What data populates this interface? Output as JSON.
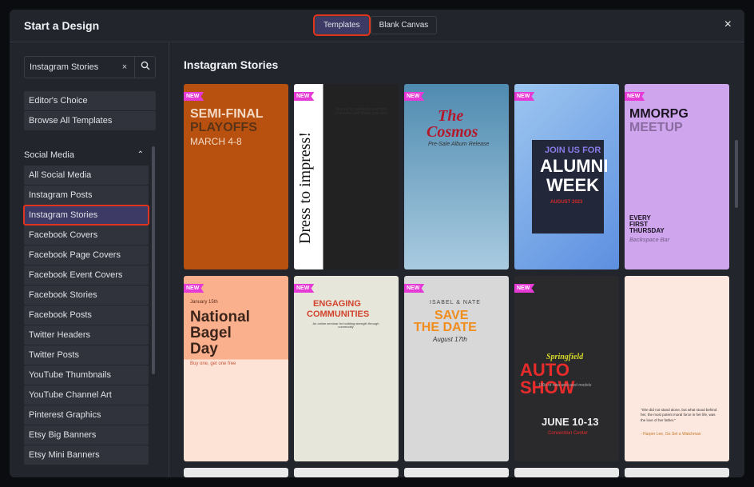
{
  "header": {
    "title": "Start a Design",
    "tabs": [
      {
        "label": "Templates",
        "active": true
      },
      {
        "label": "Blank Canvas",
        "active": false
      }
    ],
    "close_icon": "×"
  },
  "sidebar": {
    "search": {
      "value": "Instagram Stories",
      "placeholder": "",
      "clear": "×",
      "search_icon": "⚲"
    },
    "quick": [
      {
        "label": "Editor's Choice"
      },
      {
        "label": "Browse All Templates"
      }
    ],
    "section": {
      "label": "Social Media",
      "chevron": "⌃"
    },
    "items": [
      {
        "label": "All Social Media"
      },
      {
        "label": "Instagram Posts"
      },
      {
        "label": "Instagram Stories",
        "active": true
      },
      {
        "label": "Facebook Covers"
      },
      {
        "label": "Facebook Page Covers"
      },
      {
        "label": "Facebook Event Covers"
      },
      {
        "label": "Facebook Stories"
      },
      {
        "label": "Facebook Posts"
      },
      {
        "label": "Twitter Headers"
      },
      {
        "label": "Twitter Posts"
      },
      {
        "label": "YouTube Thumbnails"
      },
      {
        "label": "YouTube Channel Art"
      },
      {
        "label": "Pinterest Graphics"
      },
      {
        "label": "Etsy Big Banners"
      },
      {
        "label": "Etsy Mini Banners"
      }
    ]
  },
  "main": {
    "title": "Instagram Stories",
    "badge": "NEW",
    "cards": [
      {
        "name": "semi-final-playoffs",
        "lines": [
          "SEMI-FINAL",
          "PLAYOFFS",
          "MARCH 4-8"
        ],
        "new": true
      },
      {
        "name": "dress-to-impress",
        "lines": [
          "Dress to impress!",
          "Join us for cocktails and hors d'oeuvres and dress your best"
        ],
        "new": true
      },
      {
        "name": "the-cosmos",
        "lines": [
          "The",
          "Cosmos",
          "Pre-Sale Album Release"
        ],
        "new": true
      },
      {
        "name": "alumni-week",
        "lines": [
          "JOIN US FOR",
          "ALUMNI",
          "WEEK",
          "AUGUST 2023"
        ],
        "new": true
      },
      {
        "name": "mmorpg-meetup",
        "lines": [
          "MMORPG",
          "MEETUP",
          "EVERY FIRST THURSDAY",
          "Backspace Bar"
        ],
        "new": true
      },
      {
        "name": "national-bagel-day",
        "lines": [
          "January 15th",
          "National",
          "Bagel",
          "Day",
          "Buy one, get one free"
        ],
        "new": true
      },
      {
        "name": "engaging-communities",
        "lines": [
          "ENGAGING",
          "COMMUNITIES",
          "An online seminar for building strength through community"
        ],
        "new": true
      },
      {
        "name": "save-the-date",
        "lines": [
          "ISABEL & NATE",
          "SAVE",
          "THE DATE",
          "August 17th"
        ],
        "new": true
      },
      {
        "name": "auto-show",
        "lines": [
          "Springfield",
          "AUTO SHOW",
          "100s of new and used models",
          "JUNE 10-13",
          "Convention Center"
        ],
        "new": true
      },
      {
        "name": "quote-father",
        "lines": [
          "\"She did not stand alone, but what stood behind her, the most potent moral force in her life, was the love of her father.\"",
          "- Harper Lee, Go Set a Watchman"
        ],
        "new": false
      }
    ]
  }
}
